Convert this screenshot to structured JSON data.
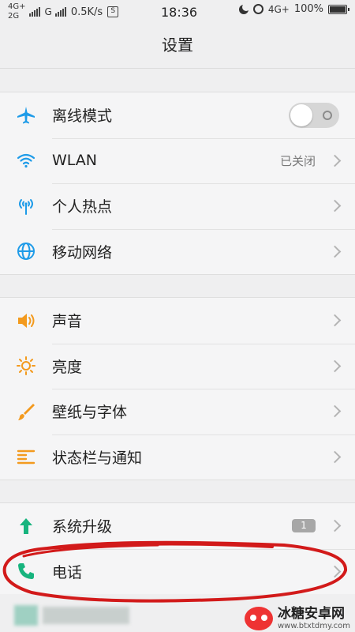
{
  "status_bar": {
    "net_top": "4G+",
    "net_bottom": "2G",
    "net_g": "G",
    "speed": "0.5K/s",
    "sim_icon": "sim-card-icon",
    "time": "18:36",
    "right_net": "4G+",
    "battery": "100%"
  },
  "title": "设置",
  "groups": [
    {
      "items": [
        {
          "label": "离线模式",
          "icon": "airplane-icon",
          "type": "toggle",
          "on": false
        },
        {
          "label": "WLAN",
          "icon": "wifi-icon",
          "value": "已关闭",
          "type": "chevron"
        },
        {
          "label": "个人热点",
          "icon": "hotspot-icon",
          "type": "chevron"
        },
        {
          "label": "移动网络",
          "icon": "globe-icon",
          "type": "chevron"
        }
      ]
    },
    {
      "items": [
        {
          "label": "声音",
          "icon": "speaker-icon",
          "type": "chevron"
        },
        {
          "label": "亮度",
          "icon": "sun-icon",
          "type": "chevron"
        },
        {
          "label": "壁纸与字体",
          "icon": "brush-icon",
          "type": "chevron"
        },
        {
          "label": "状态栏与通知",
          "icon": "notification-list-icon",
          "type": "chevron"
        }
      ]
    },
    {
      "items": [
        {
          "label": "系统升级",
          "icon": "upgrade-arrow-icon",
          "badge": "1",
          "type": "chevron"
        },
        {
          "label": "电话",
          "icon": "phone-icon",
          "type": "chevron"
        }
      ]
    }
  ],
  "watermark": {
    "title": "冰糖安卓网",
    "url": "www.btxtdmy.com"
  },
  "colors": {
    "blue": "#1e9be8",
    "orange": "#f39a1e",
    "green": "#17b47e",
    "annotation_red": "#d21a1a"
  }
}
